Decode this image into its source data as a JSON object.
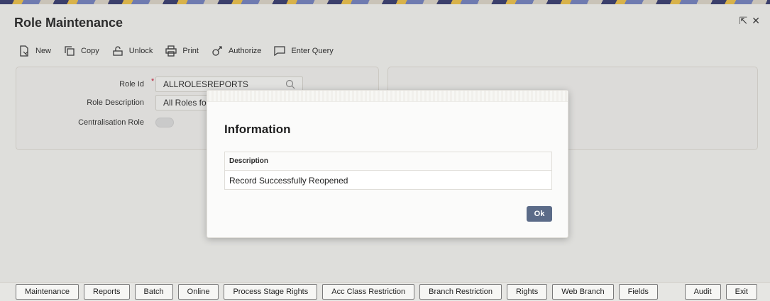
{
  "window": {
    "title": "Role Maintenance"
  },
  "toolbar": {
    "items": [
      {
        "label": "New",
        "icon": "new-document-icon"
      },
      {
        "label": "Copy",
        "icon": "copy-icon"
      },
      {
        "label": "Unlock",
        "icon": "unlock-icon"
      },
      {
        "label": "Print",
        "icon": "print-icon"
      },
      {
        "label": "Authorize",
        "icon": "authorize-icon"
      },
      {
        "label": "Enter Query",
        "icon": "enter-query-icon"
      }
    ]
  },
  "form": {
    "role_id_label": "Role Id",
    "required_marker": "*",
    "role_id_value": "ALLROLESREPORTS",
    "role_desc_label": "Role Description",
    "role_desc_value": "All Roles for R",
    "centralisation_label": "Centralisation Role",
    "centralisation_enabled": false
  },
  "dialog": {
    "title": "Information",
    "table_header": "Description",
    "message": "Record Successfully Reopened",
    "ok_label": "Ok"
  },
  "bottom_bar": {
    "buttons": [
      "Maintenance",
      "Reports",
      "Batch",
      "Online",
      "Process Stage Rights",
      "Acc Class Restriction",
      "Branch Restriction",
      "Rights",
      "Web Branch",
      "Fields"
    ],
    "audit_label": "Audit",
    "exit_label": "Exit"
  },
  "colors": {
    "primary_button": "#5b6b88",
    "required": "#c8102e"
  }
}
